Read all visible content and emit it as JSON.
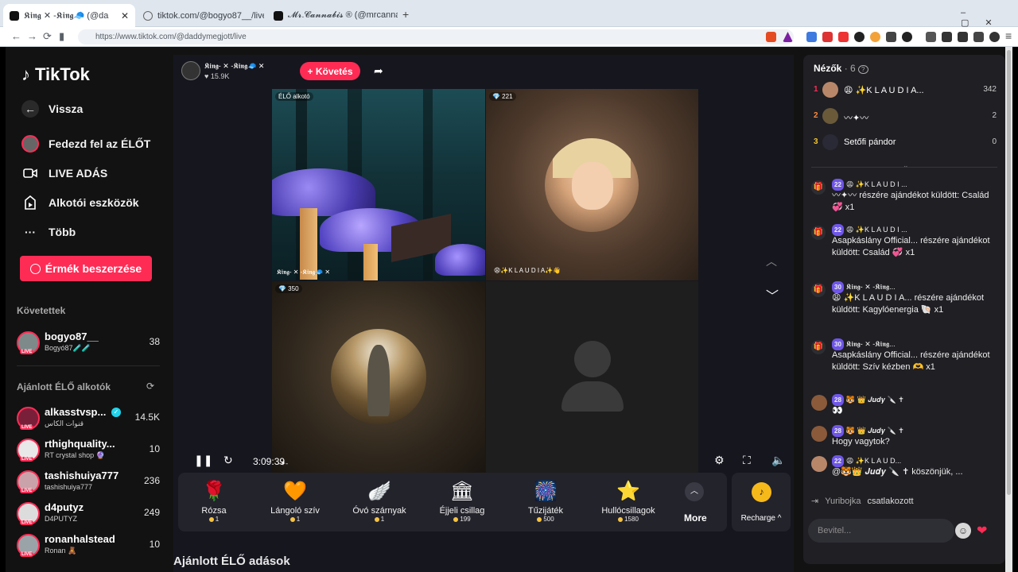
{
  "browser": {
    "tabs": [
      {
        "title": "𝕶𝖎𝖓𝖌 ✕ -𝕶𝖎𝖓𝖌🧢 (@da",
        "active": true
      },
      {
        "title": "tiktok.com/@bogyo87__/live",
        "active": false
      },
      {
        "title": "𝓜𝓻.𝓒𝓪𝓷𝓷𝓪𝓫𝓲𝓼 ® (@mrcannabis_)",
        "active": false
      }
    ],
    "new_tab": "+",
    "url": "https://www.tiktok.com/@daddymegjott/live",
    "window_controls": [
      "–",
      "▢",
      "✕"
    ]
  },
  "sidebar": {
    "logo": "TikTok",
    "back": "Vissza",
    "menu": [
      {
        "label": "Fedezd fel az ÉLŐT",
        "icon": "avatar-icon"
      },
      {
        "label": "LIVE ADÁS",
        "icon": "camera-icon"
      },
      {
        "label": "Alkotói eszközök",
        "icon": "creator-tools-icon"
      },
      {
        "label": "Több",
        "icon": "more-icon"
      }
    ],
    "coins_button": "Érmék beszerzése",
    "following_header": "Követettek",
    "following": [
      {
        "name": "bogyo87__",
        "sub": "Bogyó87🧪🧪",
        "count": "38",
        "live": "LIVE"
      }
    ],
    "recommended_header": "Ajánlott ÉLŐ alkotók",
    "recommended": [
      {
        "name": "alkasstvsp...",
        "sub": "قنوات الكاس",
        "count": "14.5K",
        "verified": true,
        "live": "LIVE"
      },
      {
        "name": "rthighquality...",
        "sub": "RT crystal shop 🔮",
        "count": "10",
        "live": "LIVE"
      },
      {
        "name": "tashishuiya777",
        "sub": "tashishuiya777",
        "count": "236",
        "live": "LIVE"
      },
      {
        "name": "d4putyz",
        "sub": "D4PUTYZ",
        "count": "249",
        "live": "LIVE"
      },
      {
        "name": "ronanhalstead",
        "sub": "Ronan 🧸",
        "count": "10",
        "live": "LIVE"
      }
    ]
  },
  "stream": {
    "host_name": "𝕶𝖎𝖓𝖌- ✕ -𝕶𝖎𝖓𝖌🧢 ✕",
    "host_likes": "♥ 15.9K",
    "follow_label": "+ Követés",
    "tiles": [
      {
        "label": "ÉLŐ alkotó"
      },
      {
        "label": "💎 221"
      },
      {
        "label": "💎 350"
      },
      {
        "label": ""
      }
    ],
    "tile_names": {
      "host": "𝕶𝖎𝖓𝖌- ✕ -𝕶𝖎𝖓𝖌🧢 ✕",
      "guest1": "😩✨K L A U D I A✨👋",
      "guest2": "-✦-"
    },
    "time": "3:09:39",
    "gifts": [
      {
        "name": "Rózsa",
        "price": "1",
        "icon": "🌹"
      },
      {
        "name": "Lángoló szív",
        "price": "1",
        "icon": "🧡"
      },
      {
        "name": "Óvó szárnyak",
        "price": "1",
        "icon": "🪽"
      },
      {
        "name": "Éjjeli csillag",
        "price": "199",
        "icon": "🏛"
      },
      {
        "name": "Tűzijáték",
        "price": "500",
        "icon": "🎆"
      },
      {
        "name": "Hullócsillagok",
        "price": "1580",
        "icon": "⭐"
      }
    ],
    "more_label": "More",
    "recharge_label": "Recharge ^",
    "recommended_live_header": "Ajánlott ÉLŐ adások"
  },
  "panel": {
    "viewers_label": "Nézők",
    "viewers_count": "· 6",
    "ranking": [
      {
        "rank": "1",
        "name": "😩 ✨K L A U D I A...",
        "score": "342"
      },
      {
        "rank": "2",
        "name": "〰✦〰",
        "score": "2"
      },
      {
        "rank": "3",
        "name": "Setőfi pándor",
        "score": "0"
      }
    ],
    "messages": [
      {
        "level": "22",
        "user": "😩 ✨K L A U D I ...",
        "text": "〰✦〰 részére ajándékot küldött: Család 💞 x1"
      },
      {
        "level": "22",
        "user": "😩 ✨K L A U D I ...",
        "text": "Asapkáslány Official... részére ajándékot küldött: Család 💞 x1"
      },
      {
        "level": "30",
        "user": "𝕶𝖎𝖓𝖌- ✕ -𝕶𝖎𝖓𝖌...",
        "text": "😩 ✨K L A U D I A... részére ajándékot küldött: Kagylóenergia 🐚 x1"
      },
      {
        "level": "30",
        "user": "𝕶𝖎𝖓𝖌- ✕ -𝕶𝖎𝖓𝖌...",
        "text": "Asapkáslány Official... részére ajándékot küldött: Szív kézben 🫶 x1"
      },
      {
        "level": "28",
        "user": "🐯 👑 𝑱𝒖𝒅𝒚 🔪 ✝",
        "text": "👀"
      },
      {
        "level": "28",
        "user": "🐯 👑 𝑱𝒖𝒅𝒚 🔪 ✝",
        "text": "Hogy vagytok?"
      },
      {
        "level": "22",
        "user": "😩 ✨K L A U D...",
        "text": "@🐯👑 𝑱𝒖𝒅𝒚 🔪 ✝ köszönjük, ..."
      }
    ],
    "joined_user": "Yuribojka",
    "joined_text": "csatlakozott",
    "input_placeholder": "Bevitel..."
  }
}
